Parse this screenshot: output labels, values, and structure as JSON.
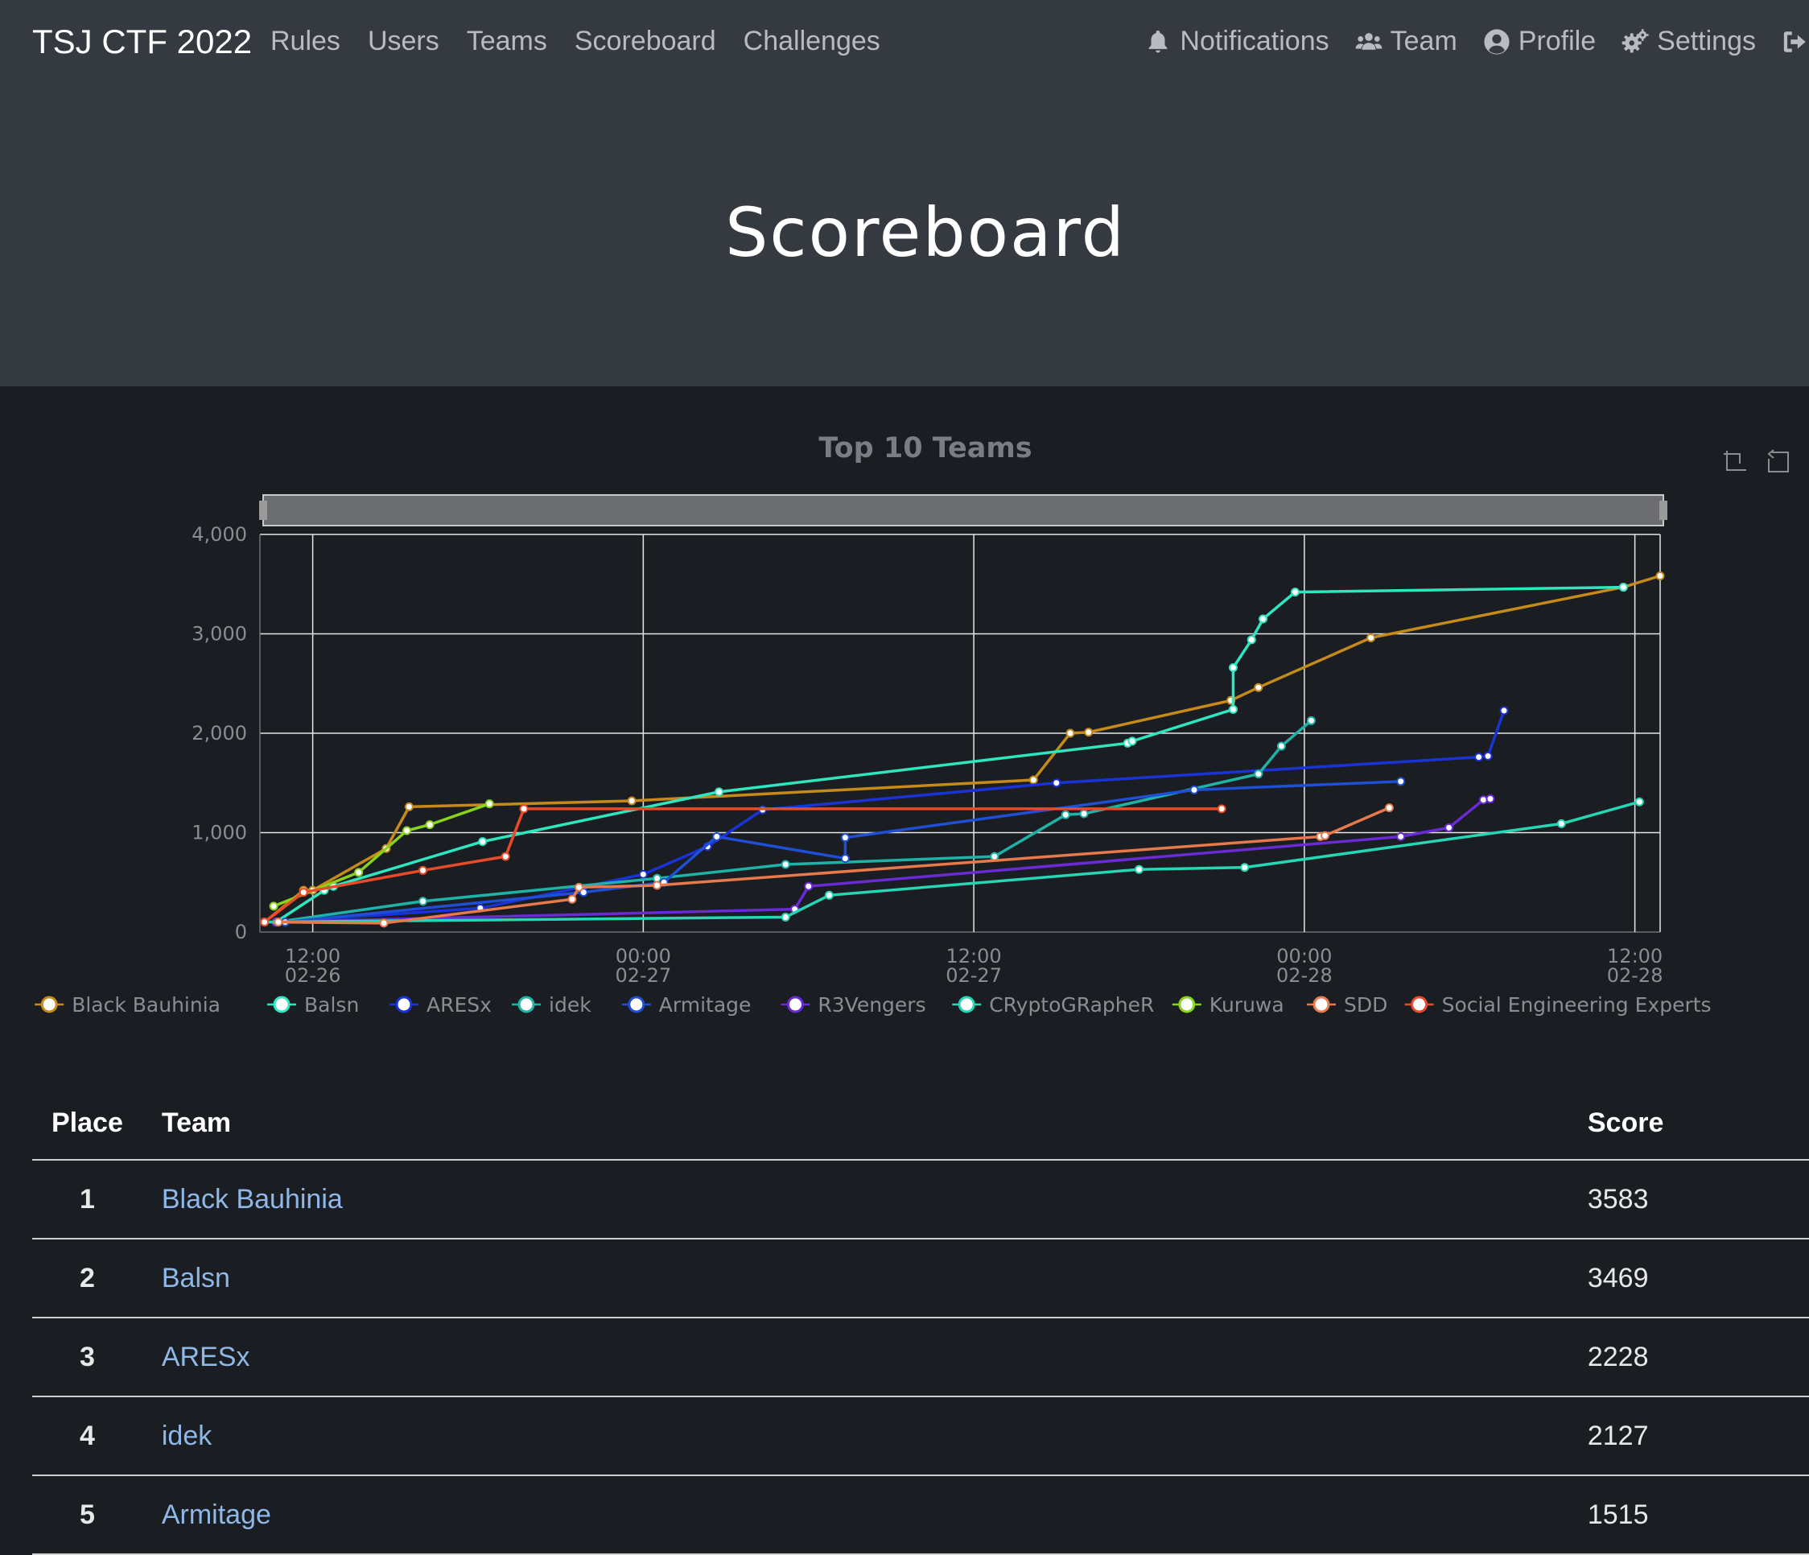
{
  "navbar": {
    "brand": "TSJ CTF 2022",
    "links": [
      {
        "label": "Rules"
      },
      {
        "label": "Users"
      },
      {
        "label": "Teams"
      },
      {
        "label": "Scoreboard"
      },
      {
        "label": "Challenges"
      }
    ],
    "right_links": [
      {
        "label": "Notifications",
        "icon": "bell-icon"
      },
      {
        "label": "Team",
        "icon": "users-icon"
      },
      {
        "label": "Profile",
        "icon": "user-circle-icon"
      },
      {
        "label": "Settings",
        "icon": "cogs-icon"
      }
    ],
    "logout_icon": "sign-out-icon"
  },
  "page_title": "Scoreboard",
  "chart_data": {
    "type": "line",
    "title": "Top 10 Teams",
    "xlabel": "",
    "ylabel": "",
    "x_ticks": [
      {
        "time": "02-26 12:00",
        "label_top": "12:00",
        "label_bottom": "02-26"
      },
      {
        "time": "02-27 00:00",
        "label_top": "00:00",
        "label_bottom": "02-27"
      },
      {
        "time": "02-27 12:00",
        "label_top": "12:00",
        "label_bottom": "02-27"
      },
      {
        "time": "02-28 00:00",
        "label_top": "00:00",
        "label_bottom": "02-28"
      },
      {
        "time": "02-28 12:00",
        "label_top": "12:00",
        "label_bottom": "02-28"
      }
    ],
    "xlim": [
      "02-26 10:05",
      "02-28 12:55"
    ],
    "ylim": [
      0,
      4000
    ],
    "y_ticks": [
      "0",
      "1,000",
      "2,000",
      "3,000",
      "4,000"
    ],
    "grid": true,
    "legend_position": "bottom",
    "dataZoom_slider": true,
    "series": [
      {
        "name": "Black Bauhinia",
        "color": "#c58a1a",
        "points": [
          [
            "02-26 10:15",
            100
          ],
          [
            "02-26 11:40",
            420
          ],
          [
            "02-26 12:00",
            420
          ],
          [
            "02-26 14:40",
            840
          ],
          [
            "02-26 15:30",
            1260
          ],
          [
            "02-26 23:35",
            1320
          ],
          [
            "02-27 14:10",
            1530
          ],
          [
            "02-27 15:30",
            2000
          ],
          [
            "02-27 16:10",
            2010
          ],
          [
            "02-27 21:20",
            2330
          ],
          [
            "02-27 22:20",
            2460
          ],
          [
            "02-28 02:25",
            2960
          ],
          [
            "02-28 11:35",
            3470
          ],
          [
            "02-28 12:55",
            3583
          ]
        ]
      },
      {
        "name": "Balsn",
        "color": "#2ee6c0",
        "points": [
          [
            "02-26 10:40",
            100
          ],
          [
            "02-26 12:25",
            420
          ],
          [
            "02-26 12:45",
            460
          ],
          [
            "02-26 18:10",
            910
          ],
          [
            "02-27 02:45",
            1410
          ],
          [
            "02-27 17:35",
            1900
          ],
          [
            "02-27 17:45",
            1920
          ],
          [
            "02-27 21:25",
            2240
          ],
          [
            "02-27 21:25",
            2660
          ],
          [
            "02-27 22:05",
            2940
          ],
          [
            "02-27 22:30",
            3150
          ],
          [
            "02-27 23:40",
            3420
          ],
          [
            "02-28 11:35",
            3469
          ]
        ]
      },
      {
        "name": "ARESx",
        "color": "#1a33d6",
        "points": [
          [
            "02-26 10:40",
            100
          ],
          [
            "02-26 18:05",
            240
          ],
          [
            "02-27 00:00",
            580
          ],
          [
            "02-27 02:20",
            860
          ],
          [
            "02-27 04:20",
            1230
          ],
          [
            "02-27 15:00",
            1500
          ],
          [
            "02-28 06:20",
            1760
          ],
          [
            "02-28 06:40",
            1770
          ],
          [
            "02-28 07:15",
            2228
          ]
        ]
      },
      {
        "name": "idek",
        "color": "#1fb3a8",
        "points": [
          [
            "02-26 10:40",
            100
          ],
          [
            "02-26 16:00",
            310
          ],
          [
            "02-27 00:30",
            540
          ],
          [
            "02-27 05:10",
            680
          ],
          [
            "02-27 12:45",
            760
          ],
          [
            "02-27 15:20",
            1180
          ],
          [
            "02-27 16:00",
            1190
          ],
          [
            "02-27 22:20",
            1590
          ],
          [
            "02-27 23:10",
            1870
          ],
          [
            "02-28 00:15",
            2127
          ]
        ]
      },
      {
        "name": "Armitage",
        "color": "#1f4fd6",
        "points": [
          [
            "02-26 10:15",
            100
          ],
          [
            "02-26 11:00",
            100
          ],
          [
            "02-26 21:50",
            400
          ],
          [
            "02-27 00:45",
            500
          ],
          [
            "02-27 02:40",
            960
          ],
          [
            "02-27 07:20",
            740
          ],
          [
            "02-27 07:20",
            950
          ],
          [
            "02-27 20:00",
            1430
          ],
          [
            "02-28 03:30",
            1515
          ]
        ]
      },
      {
        "name": "R3Vengers",
        "color": "#6a2bd6",
        "points": [
          [
            "02-26 10:40",
            100
          ],
          [
            "02-27 05:30",
            230
          ],
          [
            "02-27 06:00",
            460
          ],
          [
            "02-28 03:30",
            960
          ],
          [
            "02-28 05:15",
            1050
          ],
          [
            "02-28 06:30",
            1330
          ],
          [
            "02-28 06:45",
            1340
          ]
        ]
      },
      {
        "name": "CRyptoGRapheR",
        "color": "#26d6b5",
        "points": [
          [
            "02-26 10:15",
            100
          ],
          [
            "02-27 05:10",
            150
          ],
          [
            "02-27 06:45",
            370
          ],
          [
            "02-27 18:00",
            630
          ],
          [
            "02-27 21:50",
            650
          ],
          [
            "02-28 09:20",
            1090
          ],
          [
            "02-28 12:10",
            1310
          ]
        ]
      },
      {
        "name": "Kuruwa",
        "color": "#88d41a",
        "points": [
          [
            "02-26 10:35",
            260
          ],
          [
            "02-26 13:40",
            600
          ],
          [
            "02-26 15:25",
            1020
          ],
          [
            "02-26 16:15",
            1080
          ],
          [
            "02-26 18:25",
            1290
          ]
        ]
      },
      {
        "name": "SDD",
        "color": "#e8794a",
        "points": [
          [
            "02-26 10:45",
            100
          ],
          [
            "02-26 14:35",
            90
          ],
          [
            "02-26 21:25",
            330
          ],
          [
            "02-26 21:40",
            450
          ],
          [
            "02-27 00:30",
            470
          ],
          [
            "02-28 00:35",
            960
          ],
          [
            "02-28 00:45",
            970
          ],
          [
            "02-28 03:05",
            1250
          ]
        ]
      },
      {
        "name": "Social Engineering Experts",
        "color": "#e84a2a",
        "points": [
          [
            "02-26 10:15",
            100
          ],
          [
            "02-26 11:40",
            400
          ],
          [
            "02-26 16:00",
            620
          ],
          [
            "02-26 19:00",
            760
          ],
          [
            "02-26 19:40",
            1240
          ],
          [
            "02-27 21:00",
            1240
          ]
        ]
      }
    ]
  },
  "table": {
    "headers": {
      "place": "Place",
      "team": "Team",
      "score": "Score"
    },
    "rows": [
      {
        "place": "1",
        "team": "Black Bauhinia",
        "score": "3583"
      },
      {
        "place": "2",
        "team": "Balsn",
        "score": "3469"
      },
      {
        "place": "3",
        "team": "ARESx",
        "score": "2228"
      },
      {
        "place": "4",
        "team": "idek",
        "score": "2127"
      },
      {
        "place": "5",
        "team": "Armitage",
        "score": "1515"
      }
    ]
  }
}
